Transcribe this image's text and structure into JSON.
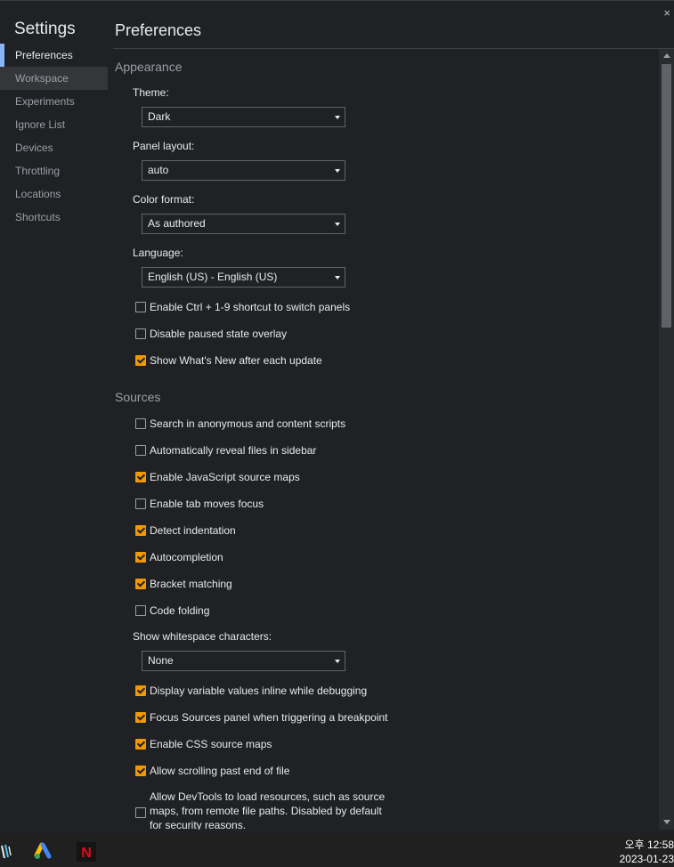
{
  "window": {
    "close_glyph": "×"
  },
  "sidebar": {
    "title": "Settings",
    "items": [
      {
        "label": "Preferences"
      },
      {
        "label": "Workspace"
      },
      {
        "label": "Experiments"
      },
      {
        "label": "Ignore List"
      },
      {
        "label": "Devices"
      },
      {
        "label": "Throttling"
      },
      {
        "label": "Locations"
      },
      {
        "label": "Shortcuts"
      }
    ]
  },
  "main": {
    "title": "Preferences",
    "appearance": {
      "heading": "Appearance",
      "theme_label": "Theme:",
      "theme_value": "Dark",
      "panel_layout_label": "Panel layout:",
      "panel_layout_value": "auto",
      "color_format_label": "Color format:",
      "color_format_value": "As authored",
      "language_label": "Language:",
      "language_value": "English (US) - English (US)",
      "checkboxes": [
        {
          "label": "Enable Ctrl + 1-9 shortcut to switch panels",
          "checked": false
        },
        {
          "label": "Disable paused state overlay",
          "checked": false
        },
        {
          "label": "Show What's New after each update",
          "checked": true
        }
      ]
    },
    "sources": {
      "heading": "Sources",
      "checkboxes": [
        {
          "label": "Search in anonymous and content scripts",
          "checked": false
        },
        {
          "label": "Automatically reveal files in sidebar",
          "checked": false
        },
        {
          "label": "Enable JavaScript source maps",
          "checked": true
        },
        {
          "label": "Enable tab moves focus",
          "checked": false
        },
        {
          "label": "Detect indentation",
          "checked": true
        },
        {
          "label": "Autocompletion",
          "checked": true
        },
        {
          "label": "Bracket matching",
          "checked": true
        },
        {
          "label": "Code folding",
          "checked": false
        }
      ],
      "whitespace_label": "Show whitespace characters:",
      "whitespace_value": "None",
      "checkboxes2": [
        {
          "label": "Display variable values inline while debugging",
          "checked": true
        },
        {
          "label": "Focus Sources panel when triggering a breakpoint",
          "checked": true
        },
        {
          "label": "Enable CSS source maps",
          "checked": true
        },
        {
          "label": "Allow scrolling past end of file",
          "checked": true
        }
      ],
      "remote_paths_label": "Allow DevTools to load resources, such as source maps, from remote file paths. Disabled by default for security reasons.",
      "remote_paths_checked": false
    }
  },
  "colors": {
    "accent": "#f29900",
    "selected_indicator": "#8ab4f8",
    "background": "#202124"
  },
  "taskbar": {
    "icons": [
      "pen-app-icon",
      "google-ads-icon",
      "netflix-icon"
    ],
    "netflix_letter": "N",
    "time": "오후 12:58",
    "date": "2023-01-23"
  }
}
